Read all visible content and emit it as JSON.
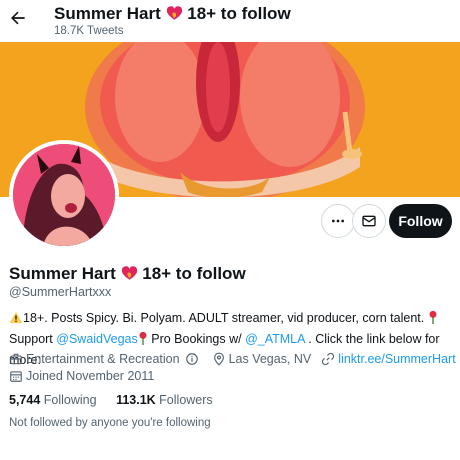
{
  "header": {
    "name_text": "Summer Hart",
    "name_suffix": "18+ to follow",
    "tweets_count": "18.7K Tweets"
  },
  "profile": {
    "display_name": "Summer Hart",
    "display_suffix": "18+ to follow",
    "handle": "@SummerHartxxx",
    "follow_label": "Follow"
  },
  "bio": {
    "line1": "18+. Posts Spicy. Bi. Polyam. ADULT streamer, vid producer, corn talent.",
    "support_label": "Support",
    "mention1": "@SwaidVegas",
    "pro_bookings": "Pro Bookings w/",
    "mention2": "@_ATMLA",
    "line2_end": ". Click the link below for more:"
  },
  "meta": {
    "category": "Entertainment & Recreation",
    "location": "Las Vegas, NV",
    "link": "linktr.ee/SummerHart",
    "joined": "Joined November 2011"
  },
  "stats": {
    "following_count": "5,744",
    "following_label": "Following",
    "followers_count": "113.1K",
    "followers_label": "Followers"
  },
  "notice": "Not followed by anyone you're following",
  "icons": {
    "back": "arrow-left-icon",
    "more": "more-horizontal-icon",
    "message": "envelope-icon",
    "category": "briefcase-icon",
    "info": "info-icon",
    "location": "location-pin-icon",
    "link": "link-icon",
    "calendar": "calendar-icon",
    "emoji_heart": "heart-fire-emoji",
    "emoji_warning": "warning-emoji",
    "emoji_rose": "rose-emoji"
  },
  "colors": {
    "accent": "#1d9bf0",
    "banner": "#f2a21a",
    "follow_button": "#0f1419",
    "muted": "#536471"
  }
}
